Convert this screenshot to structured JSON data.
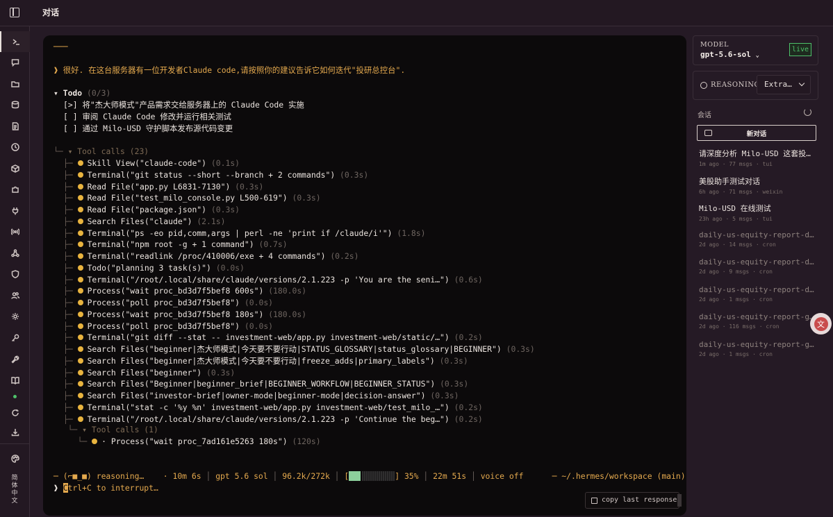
{
  "topbar": {
    "title": "对话"
  },
  "rail": {
    "items": [
      {
        "icon": "terminal-icon",
        "active": true
      },
      {
        "icon": "chat-bubble-icon"
      },
      {
        "icon": "folder-icon"
      },
      {
        "icon": "database-icon"
      },
      {
        "icon": "document-icon"
      },
      {
        "icon": "clock-icon"
      },
      {
        "icon": "cube-icon"
      },
      {
        "icon": "puzzle-icon"
      },
      {
        "icon": "plug-icon"
      },
      {
        "icon": "broadcast-icon"
      },
      {
        "icon": "share-nodes-icon"
      },
      {
        "icon": "shield-icon"
      },
      {
        "icon": "users-icon"
      },
      {
        "icon": "gear-icon"
      },
      {
        "icon": "key-icon"
      },
      {
        "icon": "wrench-icon"
      },
      {
        "icon": "book-icon"
      },
      {
        "icon": "refresh-icon"
      },
      {
        "icon": "download-icon"
      },
      {
        "icon": "palette-icon"
      }
    ],
    "language": "简体中文"
  },
  "terminal": {
    "rule": "───",
    "prompt_symbol": "❱",
    "user_message": "很好. 在这台服务器有一位开发者Claude code,请按照你的建议告诉它如何迭代\"投研总控台\".",
    "todo": {
      "title": "Todo",
      "count": "(0/3)",
      "items": [
        {
          "mark": "[>]",
          "text": "将\"杰大师模式\"产品需求交给服务器上的 Claude Code 实施"
        },
        {
          "mark": "[ ]",
          "text": "审阅 Claude Code 修改并运行相关测试"
        },
        {
          "mark": "[ ]",
          "text": "通过 Milo-USD 守护脚本发布源代码变更"
        }
      ]
    },
    "tool_calls_header": "Tool calls (23)",
    "tool_calls": [
      {
        "name": "Skill View(\"claude-code\")",
        "time": "(0.1s)"
      },
      {
        "name": "Terminal(\"git status --short --branch + 2 commands\")",
        "time": "(0.3s)"
      },
      {
        "name": "Read File(\"app.py L6831-7130\")",
        "time": "(0.3s)"
      },
      {
        "name": "Read File(\"test_milo_console.py L500-619\")",
        "time": "(0.3s)"
      },
      {
        "name": "Read File(\"package.json\")",
        "time": "(0.3s)"
      },
      {
        "name": "Search Files(\"claude\")",
        "time": "(2.1s)"
      },
      {
        "name": "Terminal(\"ps -eo pid,comm,args | perl -ne 'print if /claude/i'\")",
        "time": "(1.8s)"
      },
      {
        "name": "Terminal(\"npm root -g + 1 command\")",
        "time": "(0.7s)"
      },
      {
        "name": "Terminal(\"readlink /proc/410006/exe + 4 commands\")",
        "time": "(0.2s)"
      },
      {
        "name": "Todo(\"planning 3 task(s)\")",
        "time": "(0.0s)"
      },
      {
        "name": "Terminal(\"/root/.local/share/claude/versions/2.1.223 -p 'You are the seni…\")",
        "time": "(0.6s)"
      },
      {
        "name": "Process(\"wait proc_bd3d7f5bef8 600s\")",
        "time": "(180.0s)"
      },
      {
        "name": "Process(\"poll proc_bd3d7f5bef8\")",
        "time": "(0.0s)"
      },
      {
        "name": "Process(\"wait proc_bd3d7f5bef8 180s\")",
        "time": "(180.0s)"
      },
      {
        "name": "Process(\"poll proc_bd3d7f5bef8\")",
        "time": "(0.0s)"
      },
      {
        "name": "Terminal(\"git diff --stat -- investment-web/app.py investment-web/static/…\")",
        "time": "(0.2s)"
      },
      {
        "name": "Search Files(\"beginner|杰大师模式|今天要不要行动|STATUS_GLOSSARY|status_glossary|BEGINNER\")",
        "time": "(0.3s)"
      },
      {
        "name": "Search Files(\"beginner|杰大师模式|今天要不要行动|freeze_adds|primary_labels\")",
        "time": "(0.3s)"
      },
      {
        "name": "Search Files(\"beginner\")",
        "time": "(0.3s)"
      },
      {
        "name": "Search Files(\"Beginner|beginner_brief|BEGINNER_WORKFLOW|BEGINNER_STATUS\")",
        "time": "(0.3s)"
      },
      {
        "name": "Search Files(\"investor-brief|owner-mode|beginner-mode|decision-answer\")",
        "time": "(0.3s)"
      },
      {
        "name": "Terminal(\"stat -c '%y %n' investment-web/app.py investment-web/test_milo_…\")",
        "time": "(0.2s)"
      },
      {
        "name": "Terminal(\"/root/.local/share/claude/versions/2.1.223 -p 'Continue the beg…\")",
        "time": "(0.2s)"
      }
    ],
    "tool_calls_header_2": "Tool calls (1)",
    "tool_calls_2": [
      {
        "name": "· Process(\"wait proc_7ad161e5263 180s\")",
        "time": "(120s)"
      }
    ],
    "status": {
      "prefix": "─ (⌐■_■) reasoning…",
      "elapsed": "· 10m 6s",
      "model": "gpt 5.6 sol",
      "tokens": "96.2k/272k",
      "progress_percent": 35,
      "progress_label": "35%",
      "duration": "22m 51s",
      "voice": "voice off",
      "cwd": "─ ~/.hermes/workspace (main)"
    },
    "interrupt_hint": "trl+C to interrupt…",
    "cursor_char": "C",
    "copy_button": "copy last response"
  },
  "sidebar": {
    "model_label": "MODEL",
    "model_value": "gpt-5.6-sol",
    "live_label": "live",
    "reasoning_label": "REASONING",
    "reasoning_value": "Extra…",
    "sessions_label": "会话",
    "new_chat_label": "新对话",
    "sessions": [
      {
        "title": "请深度分析 Milo-USD 这套投…",
        "meta": "1m ago · 77 msgs · tui",
        "dim": false
      },
      {
        "title": "美股助手测试对话",
        "meta": "6h ago · 71 msgs · weixin",
        "dim": false
      },
      {
        "title": "Milo-USD 在线测试",
        "meta": "23h ago · 5 msgs · tui",
        "dim": false
      },
      {
        "title": "daily-us-equity-report-d…",
        "meta": "2d ago · 14 msgs · cron",
        "dim": true
      },
      {
        "title": "daily-us-equity-report-d…",
        "meta": "2d ago · 9 msgs · cron",
        "dim": true
      },
      {
        "title": "daily-us-equity-report-d…",
        "meta": "2d ago · 1 msgs · cron",
        "dim": true
      },
      {
        "title": "daily-us-equity-report-g…",
        "meta": "2d ago · 116 msgs · cron",
        "dim": true
      },
      {
        "title": "daily-us-equity-report-g…",
        "meta": "2d ago · 1 msgs · cron",
        "dim": true
      }
    ]
  }
}
